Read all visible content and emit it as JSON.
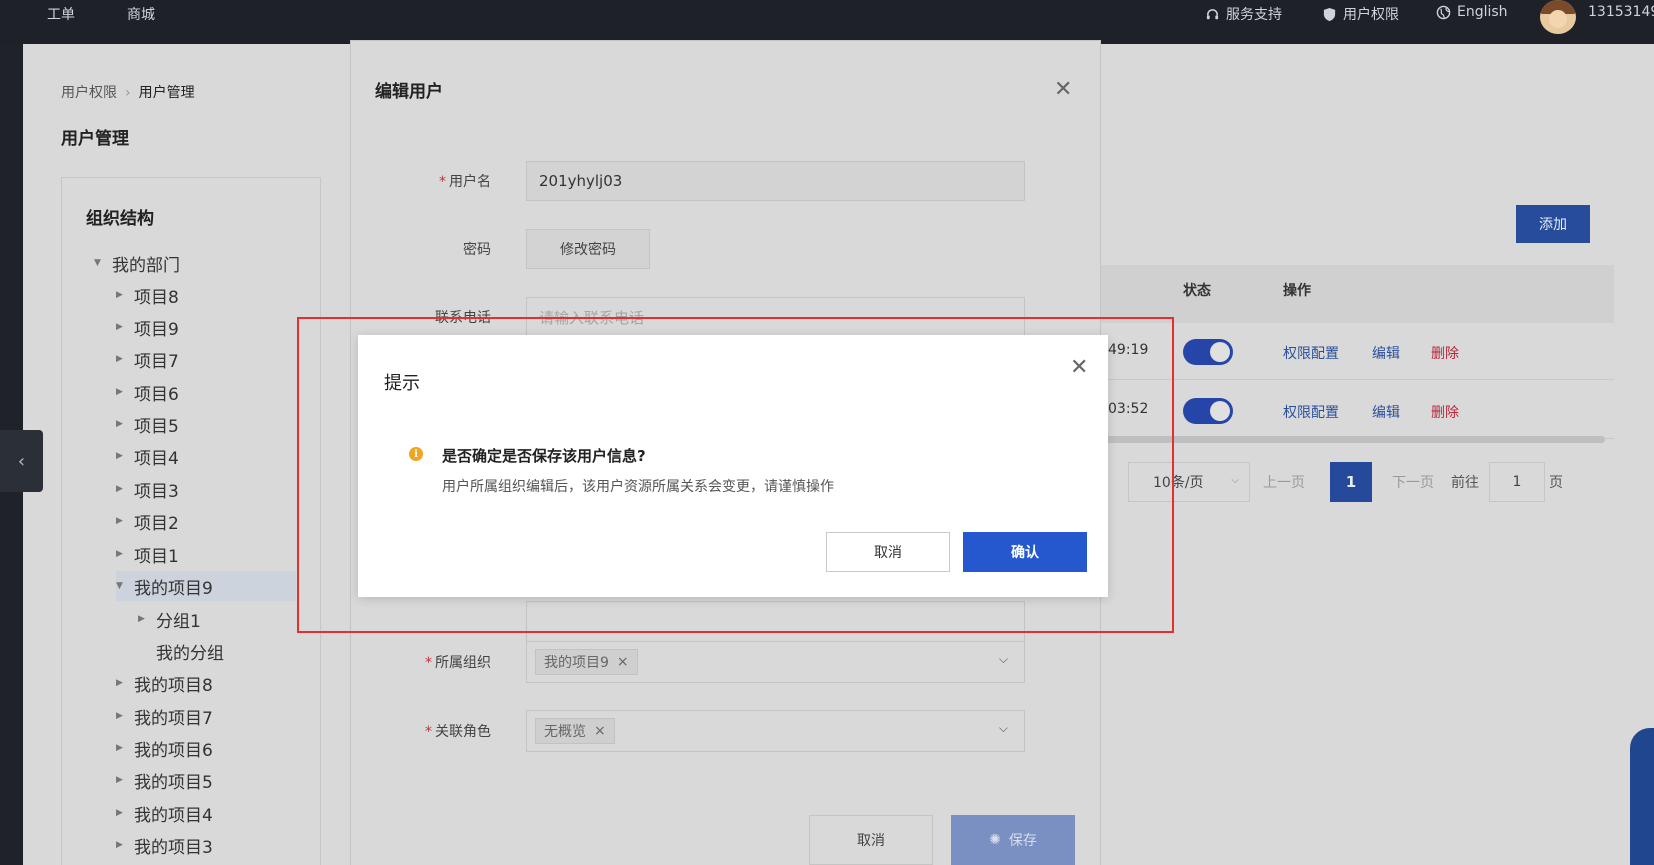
{
  "topbar": {
    "nav": [
      "工单",
      "商城"
    ],
    "support_label": "服务支持",
    "permissions_label": "用户权限",
    "language_label": "English",
    "account_label": "13153149"
  },
  "breadcrumb": {
    "parent": "用户权限",
    "current": "用户管理"
  },
  "page_title": "用户管理",
  "org": {
    "title": "组织结构",
    "nodes": [
      {
        "label": "我的部门",
        "expanded": true
      },
      {
        "label": "项目8"
      },
      {
        "label": "项目9"
      },
      {
        "label": "项目7"
      },
      {
        "label": "项目6"
      },
      {
        "label": "项目5"
      },
      {
        "label": "项目4"
      },
      {
        "label": "项目3"
      },
      {
        "label": "项目2"
      },
      {
        "label": "项目1"
      },
      {
        "label": "我的项目9",
        "expanded": true,
        "selected": true
      },
      {
        "label": "分组1"
      },
      {
        "label": "我的分组"
      },
      {
        "label": "我的项目8"
      },
      {
        "label": "我的项目7"
      },
      {
        "label": "我的项目6"
      },
      {
        "label": "我的项目5"
      },
      {
        "label": "我的项目4"
      },
      {
        "label": "我的项目3"
      }
    ]
  },
  "table": {
    "add_label": "添加",
    "col_status": "状态",
    "col_actions": "操作",
    "rows": [
      {
        "time": "49:19",
        "enabled": true,
        "action_perm": "权限配置",
        "action_edit": "编辑",
        "action_delete": "删除"
      },
      {
        "time": "03:52",
        "enabled": true,
        "action_perm": "权限配置",
        "action_edit": "编辑",
        "action_delete": "删除"
      }
    ]
  },
  "pager": {
    "page_size": "10条/页",
    "prev": "上一页",
    "current_page": "1",
    "next": "下一页",
    "goto_label": "前往",
    "goto_value": "1",
    "page_suffix": "页"
  },
  "edit_modal": {
    "title": "编辑用户",
    "username_label": "用户名",
    "username_value": "201yhylj03",
    "password_label": "密码",
    "change_password": "修改密码",
    "phone_label": "联系电话",
    "phone_placeholder": "请输入联系电话",
    "org_label": "所属组织",
    "org_tag": "我的项目9",
    "role_label": "关联角色",
    "role_tag": "无概览",
    "cancel_label": "取消",
    "save_label": "保存"
  },
  "confirm": {
    "title": "提示",
    "question": "是否确定是否保存该用户信息?",
    "description": "用户所属组织编辑后，该用户资源所属关系会变更，请谨慎操作",
    "cancel_label": "取消",
    "ok_label": "确认"
  },
  "colors": {
    "primary": "#2558cf",
    "danger": "#b9263a",
    "warning": "#f0a620",
    "highlight": "#e0302f"
  }
}
